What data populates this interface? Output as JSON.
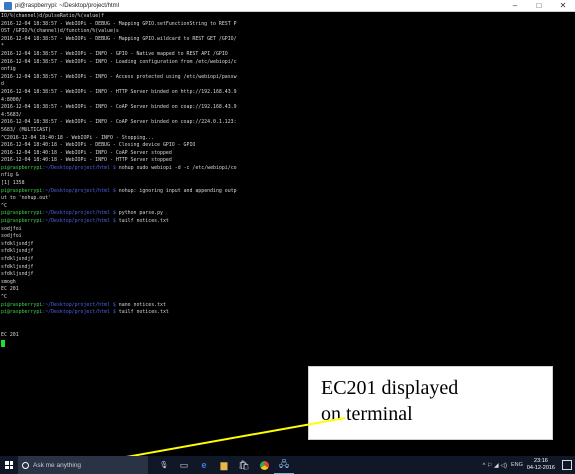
{
  "window": {
    "title": "pi@raspberrypi: ~/Desktop/project/html",
    "minimize": "–",
    "maximize": "□",
    "close": "✕"
  },
  "terminal": {
    "lines": [
      {
        "text": "IO/%(channel)d/pulseRatio/%(value)f"
      },
      {
        "text": "2016-12-04 18:38:57 - WebIOPi - DEBUG - Mapping GPIO.setFunctionString to REST P"
      },
      {
        "text": "OST /GPIO/%(channel)d/function/%(value)s"
      },
      {
        "text": "2016-12-04 18:38:57 - WebIOPi - DEBUG - Mapping GPIO.wildcard to REST GET /GPIO/"
      },
      {
        "text": "*"
      },
      {
        "text": "2016-12-04 18:38:57 - WebIOPi - INFO - GPIO - Native mapped to REST API /GPIO"
      },
      {
        "text": "2016-12-04 18:38:57 - WebIOPi - INFO - Loading configuration from /etc/webiopi/c"
      },
      {
        "text": "onfig"
      },
      {
        "text": "2016-12-04 18:38:57 - WebIOPi - INFO - Access protected using /etc/webiopi/passw"
      },
      {
        "text": "d"
      },
      {
        "text": "2016-12-04 18:38:57 - WebIOPi - INFO - HTTP Server binded on http://192.168.43.9"
      },
      {
        "text": "4:8000/"
      },
      {
        "text": "2016-12-04 18:38:57 - WebIOPi - INFO - CoAP Server binded on coap://192.168.43.9"
      },
      {
        "text": "4:5683/"
      },
      {
        "text": "2016-12-04 18:38:57 - WebIOPi - INFO - CoAP Server binded on coap://224.0.1.123:"
      },
      {
        "text": "5683/ (MULTICAST)"
      },
      {
        "text": "^C2016-12-04 18:40:18 - WebIOPi - INFO - Stopping..."
      },
      {
        "text": "2016-12-04 18:40:18 - WebIOPi - DEBUG - Closing device GPIO - GPIO"
      },
      {
        "text": "2016-12-04 18:40:18 - WebIOPi - INFO - CoAP Server stopped"
      },
      {
        "text": "2016-12-04 18:40:18 - WebIOPi - INFO - HTTP Server stopped"
      },
      {
        "user": "pi@raspberrypi",
        "path": ":~/Desktop/project/html $",
        "text": " nohup sudo webiopi -d -c /etc/webiopi/co"
      },
      {
        "text": "nfig &"
      },
      {
        "text": "[1] 1358"
      },
      {
        "user": "pi@raspberrypi",
        "path": ":~/Desktop/project/html $",
        "text": " nohup: ignoring input and appending outp"
      },
      {
        "text": "ut to 'nohup.out'"
      },
      {
        "text": "^C"
      },
      {
        "user": "pi@raspberrypi",
        "path": ":~/Desktop/project/html $",
        "text": " python parse.py"
      },
      {
        "user": "pi@raspberrypi",
        "path": ":~/Desktop/project/html $",
        "text": " tailf notices.txt"
      },
      {
        "text": "sodjfoi"
      },
      {
        "text": "sodjfoi"
      },
      {
        "text": "sfdkljsndjf"
      },
      {
        "text": "sfdkljsndjf"
      },
      {
        "text": "sfdkljsndjf"
      },
      {
        "text": "sfdkljsndjf"
      },
      {
        "text": "sfdkljsndjf"
      },
      {
        "text": "smogh"
      },
      {
        "text": "EC 201"
      },
      {
        "text": "^C"
      },
      {
        "user": "pi@raspberrypi",
        "path": ":~/Desktop/project/html $",
        "text": " nano notices.txt"
      },
      {
        "user": "pi@raspberrypi",
        "path": ":~/Desktop/project/html $",
        "text": " tailf notices.txt"
      },
      {
        "text": ""
      },
      {
        "text": ""
      },
      {
        "text": "EC 201"
      }
    ]
  },
  "callout": {
    "line1": "EC201 displayed",
    "line2": "on terminal",
    "arrow_color": "#ffff00"
  },
  "taskbar": {
    "search_placeholder": "Ask me anything",
    "tray_icons": "^ ⚐ ◢ ◁)",
    "language": "ENG",
    "time": "23:16",
    "date": "04-12-2016"
  },
  "colors": {
    "terminal_bg": "#000000",
    "prompt_user": "#3fd04a",
    "prompt_path": "#4a61e8",
    "cursor": "#1ee02f",
    "taskbar_bg": "#101727"
  },
  "icons": [
    "putty-app-icon",
    "minimize-icon",
    "maximize-icon",
    "close-icon",
    "windows-start-icon",
    "cortana-icon",
    "microphone-icon",
    "task-view-icon",
    "edge-icon",
    "file-explorer-icon",
    "store-icon",
    "chrome-icon",
    "putty-icon",
    "notification-icon"
  ]
}
